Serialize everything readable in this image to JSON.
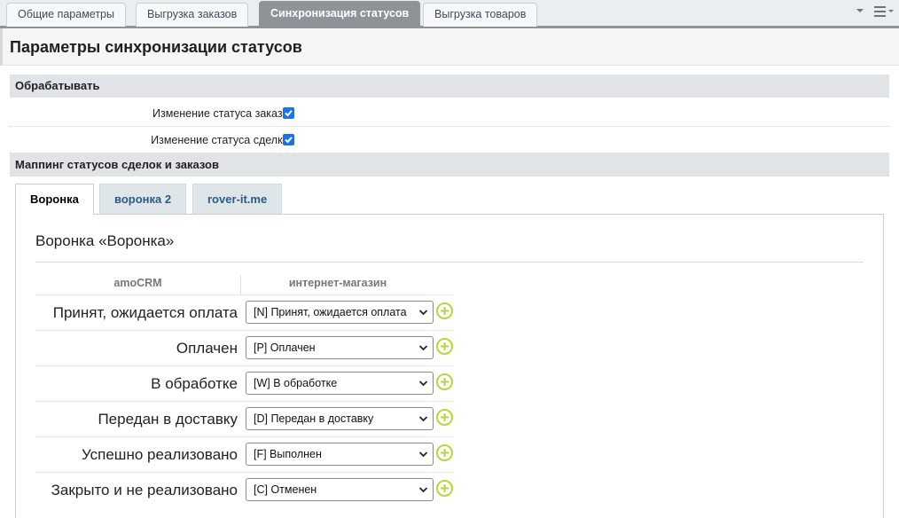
{
  "top_tabs": [
    {
      "label": "Общие параметры"
    },
    {
      "label": "Выгрузка заказов"
    },
    {
      "label": "Синхронизация статусов",
      "active": true
    },
    {
      "label": "Выгрузка товаров"
    }
  ],
  "icons": {
    "dropdown": "chevron-down-icon",
    "menu": "hamburger-menu-icon",
    "add": "plus-circle-icon",
    "check": "check-icon"
  },
  "page": {
    "title": "Параметры синхронизации статусов"
  },
  "process": {
    "header": "Обрабатывать",
    "options": [
      {
        "label": "Изменение статуса заказа:",
        "checked": true
      },
      {
        "label": "Изменение статуса сделки:",
        "checked": true
      }
    ]
  },
  "mapping": {
    "header": "Маппинг статусов сделок и заказов",
    "tabs": [
      {
        "label": "Воронка",
        "active": true
      },
      {
        "label": "воронка 2"
      },
      {
        "label": "rover-it.me"
      }
    ],
    "funnel_title": "Воронка «Воронка»",
    "columns": {
      "left": "amoCRM",
      "right": "интернет-магазин"
    },
    "rows": [
      {
        "status": "Принят, ожидается оплата",
        "selected": "[N] Принят, ожидается оплата"
      },
      {
        "status": "Оплачен",
        "selected": "[P] Оплачен"
      },
      {
        "status": "В обработке",
        "selected": "[W] В обработке"
      },
      {
        "status": "Передан в доставку",
        "selected": "[D] Передан в доставку"
      },
      {
        "status": "Успешно реализовано",
        "selected": "[F] Выполнен"
      },
      {
        "status": "Закрыто и не реализовано",
        "selected": "[C] Отменен"
      }
    ]
  },
  "colors": {
    "accent_checkbox": "#1a73e8",
    "add_icon": "#b8d734",
    "active_tab": "#8d9397"
  }
}
